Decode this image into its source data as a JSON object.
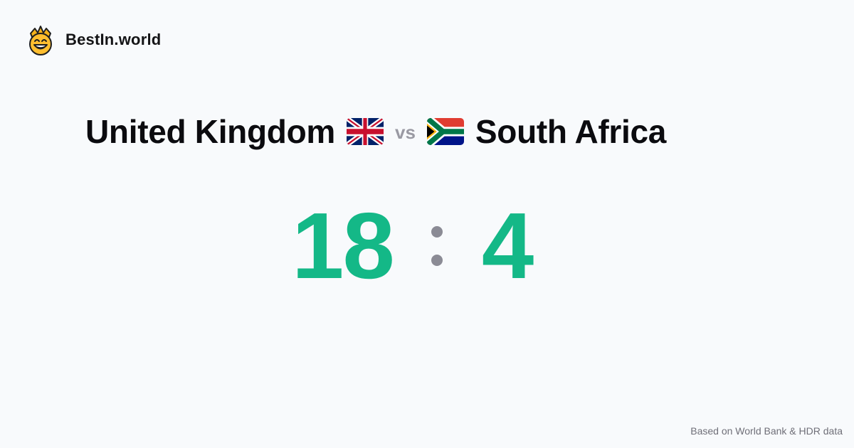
{
  "header": {
    "brand_name": "BestIn.world",
    "logo_icon": "crowned-smiley-icon"
  },
  "matchup": {
    "country_1": {
      "name": "United Kingdom",
      "flag_icon": "uk-flag-icon"
    },
    "vs_label": "vs",
    "country_2": {
      "name": "South Africa",
      "flag_icon": "south-africa-flag-icon"
    }
  },
  "score": {
    "left": "18",
    "right": "4"
  },
  "footer": {
    "source_note": "Based on World Bank & HDR data"
  },
  "colors": {
    "background": "#f8fafc",
    "score": "#14b887",
    "muted": "#8b8b95"
  }
}
